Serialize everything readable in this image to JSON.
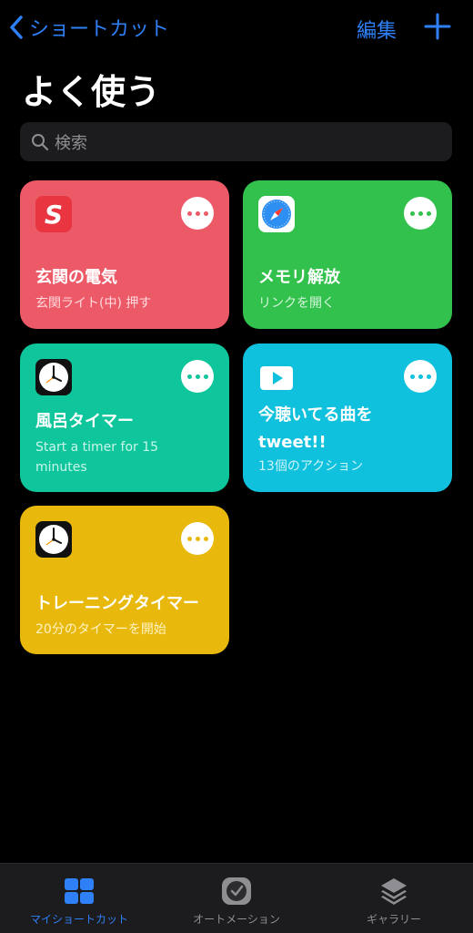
{
  "nav": {
    "back_label": "ショートカット",
    "edit_label": "編集"
  },
  "page": {
    "title": "よく使う"
  },
  "search": {
    "placeholder": "検索"
  },
  "cards": [
    {
      "name": "玄関の電気",
      "sub": "玄関ライト(中) 押す",
      "color": "#ec5a68",
      "icon": "s-app-icon"
    },
    {
      "name": "メモリ解放",
      "sub": "リンクを開く",
      "color": "#33c14d",
      "icon": "safari-icon"
    },
    {
      "name": "風呂タイマー",
      "sub": "Start a timer for 15 minutes",
      "color": "#0fc59b",
      "icon": "clock-icon"
    },
    {
      "name": "今聴いてる曲をtweet!!",
      "sub": "13個のアクション",
      "color": "#0fc1dc",
      "icon": "play-icon"
    },
    {
      "name": "トレーニングタイマー",
      "sub": "20分のタイマーを開始",
      "color": "#e9b80c",
      "icon": "clock-icon"
    }
  ],
  "tabs": [
    {
      "label": "マイショートカット",
      "icon": "grid-icon",
      "active": true
    },
    {
      "label": "オートメーション",
      "icon": "automation-clock-icon",
      "active": false
    },
    {
      "label": "ギャラリー",
      "icon": "gallery-stack-icon",
      "active": false
    }
  ],
  "colors": {
    "accent": "#2f7ff6"
  }
}
